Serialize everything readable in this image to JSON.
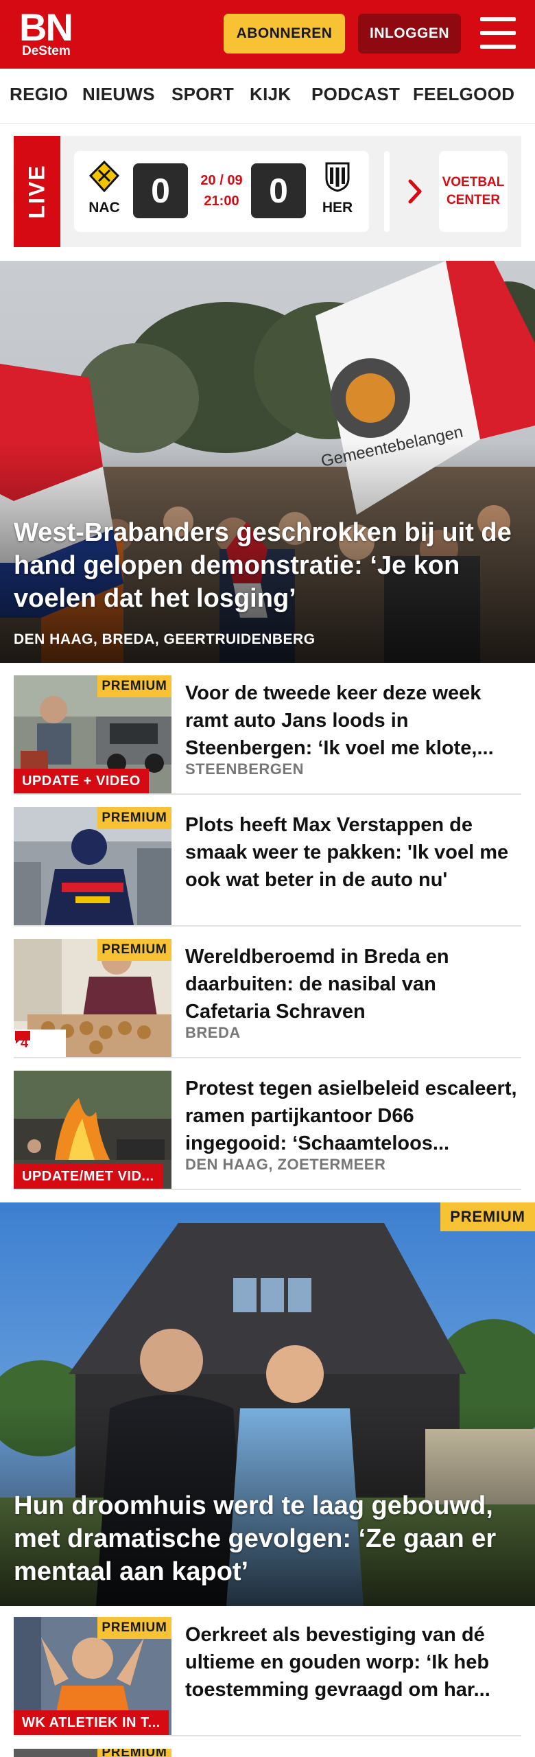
{
  "header": {
    "logo_main": "BN",
    "logo_sub": "DeStem",
    "subscribe_label": "ABONNEREN",
    "login_label": "INLOGGEN",
    "menu_icon": "hamburger-menu-icon",
    "brand_color": "#d60a12",
    "accent_color": "#f7c234"
  },
  "nav": {
    "items": [
      "REGIO",
      "NIEUWS",
      "SPORT",
      "KIJK",
      "PODCAST",
      "FEELGOOD"
    ]
  },
  "live": {
    "label": "LIVE",
    "home_team": "NAC",
    "away_team": "HER",
    "home_score": "0",
    "away_score": "0",
    "date": "20 / 09",
    "time": "21:00",
    "football_center": "VOETBAL CENTER"
  },
  "hero": {
    "headline": "West-Brabanders geschrokken bij uit de hand gelopen demonstratie: ‘Je kon voelen dat het losging’",
    "location": "DEN HAAG, BREDA, GEERTRUIDENBERG"
  },
  "articles": [
    {
      "premium": "PREMIUM",
      "label": "UPDATE + VIDEO",
      "title": "Voor de tweede keer deze week ramt auto Jans loods in Steenbergen: ‘Ik voel me klote,...",
      "location": "STEENBERGEN"
    },
    {
      "premium": "PREMIUM",
      "title": "Plots heeft Max Verstappen de smaak weer te pakken: 'Ik voel me ook wat beter in de auto nu'"
    },
    {
      "premium": "PREMIUM",
      "comments": "4",
      "title": "Wereldberoemd in Breda en daarbuiten: de nasibal van Cafetaria Schraven",
      "location": "BREDA"
    },
    {
      "label": "UPDATE/MET VID...",
      "title": "Protest tegen asielbeleid escaleert, ramen partijkantoor D66 ingegooid: ‘Schaamteloos...",
      "location": "DEN HAAG, ZOETERMEER"
    }
  ],
  "feature": {
    "premium": "PREMIUM",
    "headline": "Hun droomhuis werd te laag gebouwd, met dramatische gevolgen: ‘Ze gaan er mentaal aan kapot’"
  },
  "article5": {
    "premium": "PREMIUM",
    "label": "WK ATLETIEK IN T...",
    "title": "Oerkreet als bevestiging van dé ultieme en gouden worp: ‘Ik heb toestemming gevraagd om har..."
  },
  "article6": {
    "premium": "PREMIUM"
  }
}
